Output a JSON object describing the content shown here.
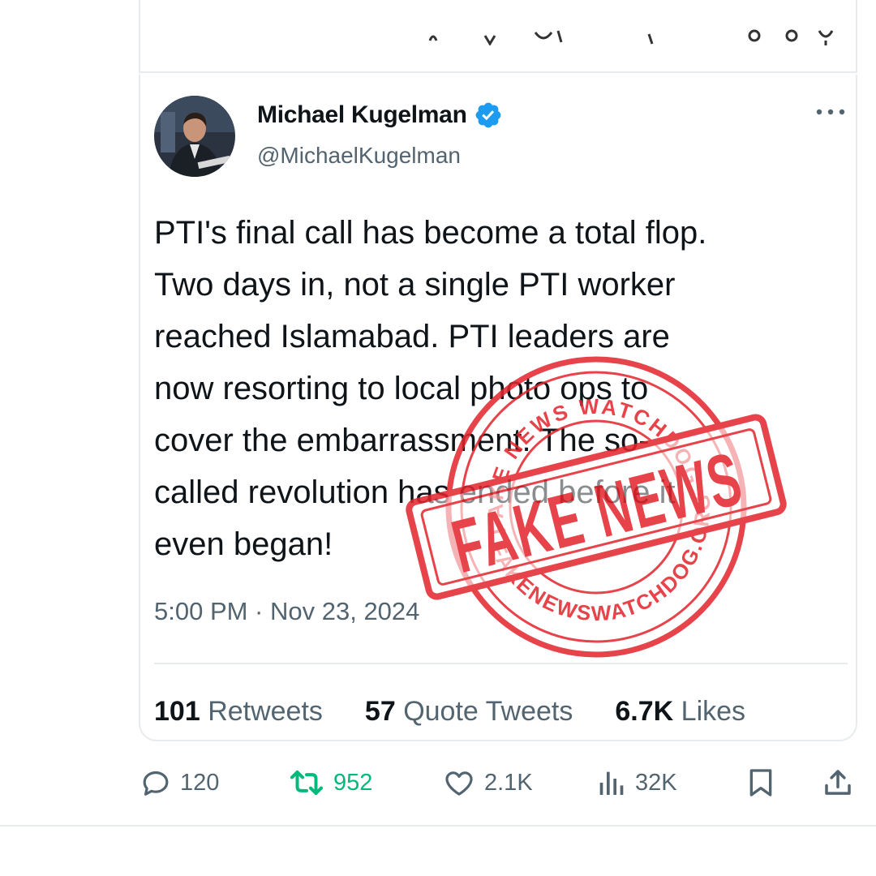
{
  "tweet": {
    "author_name": "Michael Kugelman",
    "author_handle": "@MichaelKugelman",
    "text_lines": [
      "PTI's final call has become a total flop.",
      "Two days in, not a single PTI worker",
      "reached Islamabad. PTI leaders are",
      "now resorting to local photo ops to",
      "cover the embarrassment. The so-",
      "called revolution has ended before it",
      "even began!"
    ],
    "timestamp": "5:00 PM · Nov 23, 2024",
    "stats": {
      "retweets_count": "101",
      "retweets_label": "Retweets",
      "quotes_count": "57",
      "quotes_label": "Quote Tweets",
      "likes_count": "6.7K",
      "likes_label": "Likes"
    }
  },
  "actions": {
    "replies": "120",
    "retweets": "952",
    "likes": "2.1K",
    "views": "32K"
  },
  "stamp": {
    "main_text": "FAKE NEWS",
    "top_arc_text": "FAKE NEWS WATCHDOG",
    "bottom_arc_text": "FAKENEWSWATCHDOG.ORG"
  },
  "colors": {
    "text_primary": "#0f1419",
    "text_secondary": "#536471",
    "verified_blue": "#1d9bf0",
    "retweet_green": "#00ba7c",
    "stamp_red": "#e4252d",
    "border": "#e8ebed"
  },
  "icons": [
    "verified-badge-icon",
    "more-icon",
    "reply-icon",
    "retweet-icon",
    "like-icon",
    "views-icon",
    "bookmark-icon",
    "share-icon"
  ]
}
